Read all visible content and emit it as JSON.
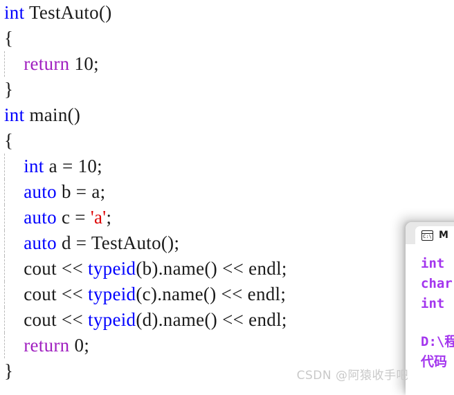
{
  "editor": {
    "language": "cpp",
    "colors": {
      "keyword": "#0000ff",
      "return_keyword": "#a020c0",
      "char_literal": "#dd0000",
      "plain_text": "#1a1a1a",
      "background": "#ffffff",
      "indent_guide": "#b9b9b9"
    },
    "lines": [
      {
        "id": "l1",
        "indent": 0,
        "guide": false,
        "tokens": [
          {
            "t": "int",
            "c": "kw"
          },
          {
            "t": " TestAuto()",
            "c": "plain"
          }
        ]
      },
      {
        "id": "l2",
        "indent": 0,
        "guide": false,
        "tokens": [
          {
            "t": "{",
            "c": "brace"
          }
        ]
      },
      {
        "id": "l3",
        "indent": 1,
        "guide": true,
        "tokens": [
          {
            "t": "    ",
            "c": "plain"
          },
          {
            "t": "return",
            "c": "ret"
          },
          {
            "t": " 10;",
            "c": "plain"
          }
        ]
      },
      {
        "id": "l4",
        "indent": 0,
        "guide": false,
        "tokens": [
          {
            "t": "}",
            "c": "brace"
          }
        ]
      },
      {
        "id": "l5",
        "indent": 0,
        "guide": false,
        "tokens": [
          {
            "t": "int",
            "c": "kw"
          },
          {
            "t": " main()",
            "c": "plain"
          }
        ]
      },
      {
        "id": "l6",
        "indent": 0,
        "guide": false,
        "tokens": [
          {
            "t": "{",
            "c": "brace"
          }
        ]
      },
      {
        "id": "l7",
        "indent": 1,
        "guide": true,
        "tokens": [
          {
            "t": "    ",
            "c": "plain"
          },
          {
            "t": "int",
            "c": "kw"
          },
          {
            "t": " a = 10;",
            "c": "plain"
          }
        ]
      },
      {
        "id": "l8",
        "indent": 1,
        "guide": true,
        "tokens": [
          {
            "t": "    ",
            "c": "plain"
          },
          {
            "t": "auto",
            "c": "kw"
          },
          {
            "t": " b = a;",
            "c": "plain"
          }
        ]
      },
      {
        "id": "l9",
        "indent": 1,
        "guide": true,
        "tokens": [
          {
            "t": "    ",
            "c": "plain"
          },
          {
            "t": "auto",
            "c": "kw"
          },
          {
            "t": " c = ",
            "c": "plain"
          },
          {
            "t": "'a'",
            "c": "lit"
          },
          {
            "t": ";",
            "c": "plain"
          }
        ]
      },
      {
        "id": "l10",
        "indent": 1,
        "guide": true,
        "tokens": [
          {
            "t": "    ",
            "c": "plain"
          },
          {
            "t": "auto",
            "c": "kw"
          },
          {
            "t": " d = TestAuto();",
            "c": "plain"
          }
        ]
      },
      {
        "id": "l11",
        "indent": 1,
        "guide": true,
        "tokens": [
          {
            "t": "    cout << ",
            "c": "plain"
          },
          {
            "t": "typeid",
            "c": "kw"
          },
          {
            "t": "(b).name() << endl;",
            "c": "plain"
          }
        ]
      },
      {
        "id": "l12",
        "indent": 1,
        "guide": true,
        "tokens": [
          {
            "t": "    cout << ",
            "c": "plain"
          },
          {
            "t": "typeid",
            "c": "kw"
          },
          {
            "t": "(c).name() << endl;",
            "c": "plain"
          }
        ]
      },
      {
        "id": "l13",
        "indent": 1,
        "guide": true,
        "tokens": [
          {
            "t": "    cout << ",
            "c": "plain"
          },
          {
            "t": "typeid",
            "c": "kw"
          },
          {
            "t": "(d).name() << endl;",
            "c": "plain"
          }
        ]
      },
      {
        "id": "l14",
        "indent": 1,
        "guide": true,
        "tokens": [
          {
            "t": "    ",
            "c": "plain"
          },
          {
            "t": "return",
            "c": "ret"
          },
          {
            "t": " 0;",
            "c": "plain"
          }
        ]
      },
      {
        "id": "l15",
        "indent": 0,
        "guide": false,
        "tokens": [
          {
            "t": "}",
            "c": "brace"
          }
        ]
      }
    ]
  },
  "console": {
    "tab_icon": "terminal-icon",
    "tab_icon_label": "C:\\",
    "tab_title": "M",
    "text_color": "#a335ee",
    "output_lines": [
      "int",
      "char",
      "int"
    ],
    "path_line": "D:\\程",
    "path_line_2": "代码"
  },
  "watermark": {
    "text": "CSDN @阿猿收手吧"
  }
}
